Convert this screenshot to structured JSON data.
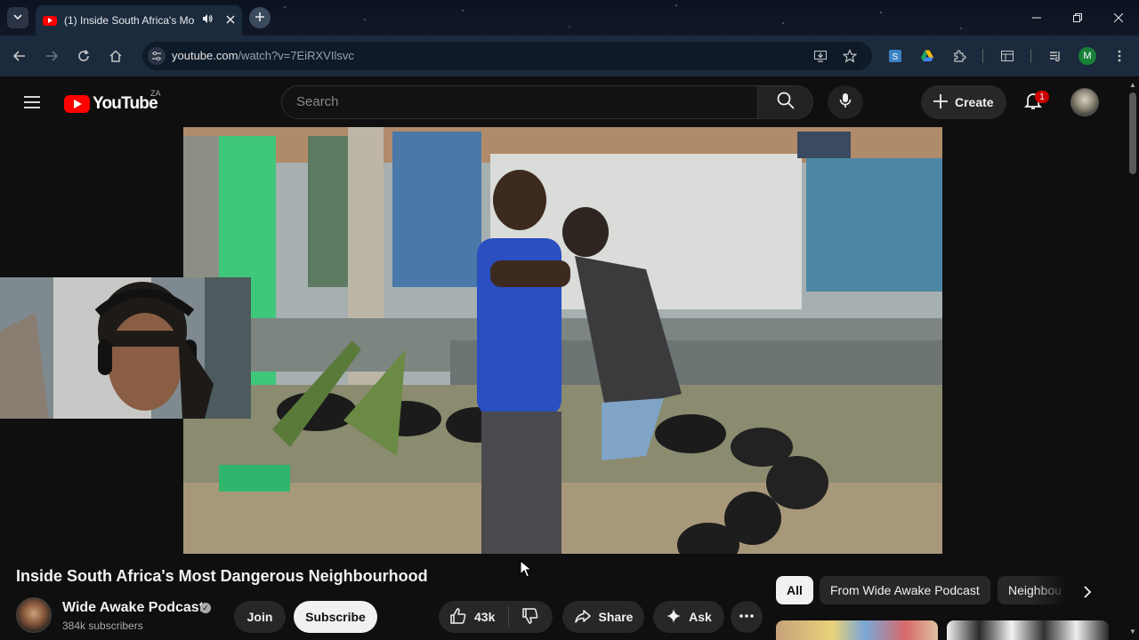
{
  "browser": {
    "tab_title": "(1) Inside South Africa's Mo",
    "url_host": "youtube.com",
    "url_path": "/watch?v=7EiRXVIlsvc",
    "profile_initial": "M"
  },
  "youtube": {
    "logo_text": "YouTube",
    "country_code": "ZA",
    "search_placeholder": "Search",
    "create_label": "Create",
    "notification_count": "1"
  },
  "video": {
    "title": "Inside South Africa's Most Dangerous Neighbourhood",
    "channel_name": "Wide Awake Podcast",
    "subscribers": "384k subscribers",
    "join_label": "Join",
    "subscribe_label": "Subscribe",
    "like_count": "43k",
    "share_label": "Share",
    "ask_label": "Ask"
  },
  "chips": {
    "all": "All",
    "from_channel": "From Wide Awake Podcast",
    "neighbourhood": "Neighbou"
  },
  "colors": {
    "brand_red": "#ff0000",
    "page_bg": "#0f0f0f",
    "chrome_bg": "#1c2a3d"
  },
  "icons": [
    "chevron-down-icon",
    "speaker-icon",
    "close-icon",
    "plus-icon",
    "back-icon",
    "forward-icon",
    "reload-icon",
    "home-icon",
    "site-info-icon",
    "install-icon",
    "star-icon",
    "extension-icon",
    "menu-icon",
    "search-icon",
    "mic-icon",
    "bell-icon",
    "like-icon",
    "dislike-icon",
    "share-icon",
    "sparkle-icon",
    "more-icon",
    "chevron-right-icon"
  ]
}
